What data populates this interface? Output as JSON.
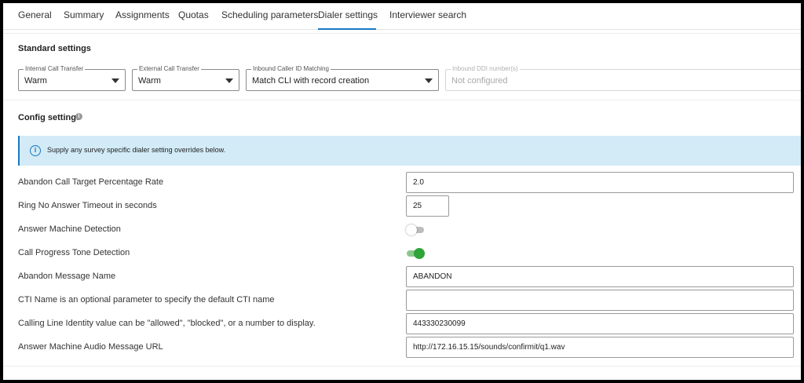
{
  "tabs": [
    {
      "label": "General"
    },
    {
      "label": "Summary"
    },
    {
      "label": "Assignments"
    },
    {
      "label": "Quotas"
    },
    {
      "label": "Scheduling parameters"
    },
    {
      "label": "Dialer settings",
      "active": true
    },
    {
      "label": "Interviewer search"
    }
  ],
  "standard": {
    "title": "Standard settings",
    "fields": [
      {
        "label": "Internal Call Transfer",
        "value": "Warm"
      },
      {
        "label": "External Call Transfer",
        "value": "Warm"
      },
      {
        "label": "Inbound Caller ID Matching",
        "value": "Match CLI with record creation"
      },
      {
        "label": "Inbound DDI number(s)",
        "value": "Not configured",
        "disabled": true
      }
    ]
  },
  "config": {
    "title": "Config settings",
    "banner": "Supply any survey specific dialer setting overrides below.",
    "rows": [
      {
        "label": "Abandon Call Target Percentage Rate",
        "value": "2.0"
      },
      {
        "label": "Ring No Answer Timeout in seconds",
        "value": "25"
      },
      {
        "label": "Answer Machine Detection",
        "state": "off"
      },
      {
        "label": "Call Progress Tone Detection",
        "state": "on"
      },
      {
        "label": "Abandon Message Name",
        "value": "ABANDON"
      },
      {
        "label": "CTI Name is an optional parameter to specify the default CTI name",
        "value": ""
      },
      {
        "label": "Calling Line Identity value can be \"allowed\", \"blocked\", or a number to display.",
        "value": "443330230099"
      },
      {
        "label": "Answer Machine Audio Message URL",
        "value": "http://172.16.15.15/sounds/confirmit/q1.wav"
      }
    ]
  },
  "colors": {
    "accent": "#1a78c2",
    "banner_bg": "#d2ebf7",
    "toggle_on": "#2ea43a"
  }
}
